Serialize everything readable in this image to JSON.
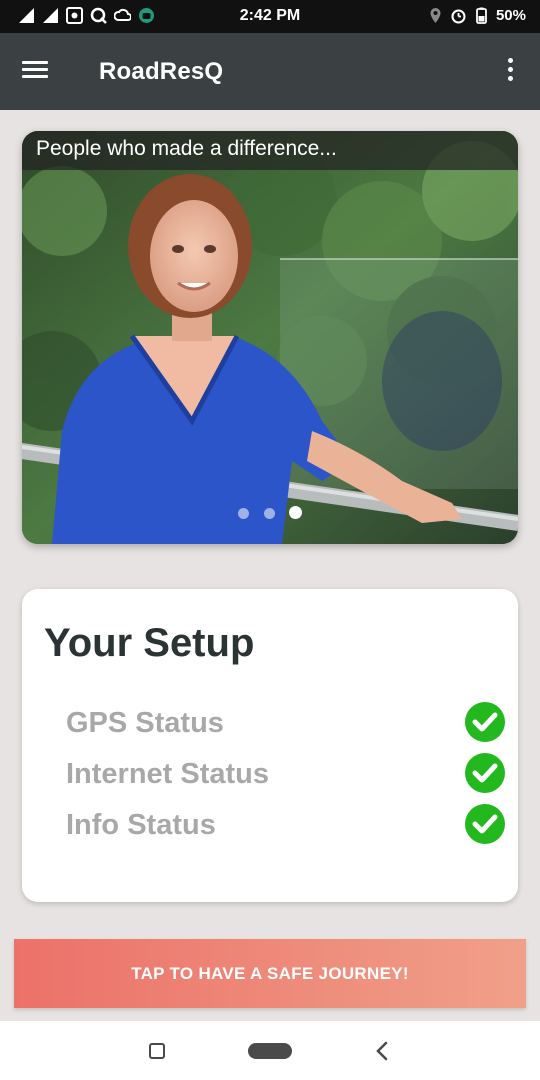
{
  "status_bar": {
    "time": "2:42 PM",
    "battery": "50%",
    "left_icons": [
      "signal-icon",
      "signal-icon",
      "notification-icon",
      "q-icon",
      "cloud-icon",
      "android-icon"
    ],
    "right_icons": [
      "location-icon",
      "alarm-icon",
      "battery-icon"
    ]
  },
  "app_bar": {
    "title": "RoadResQ",
    "menu_icon": "hamburger-menu-icon",
    "overflow_icon": "more-vert-icon"
  },
  "carousel": {
    "caption": "People who made a difference...",
    "slide_count": 3,
    "active_index": 2
  },
  "setup": {
    "title": "Your Setup",
    "items": [
      {
        "label": "GPS Status",
        "ok": true
      },
      {
        "label": "Internet Status",
        "ok": true
      },
      {
        "label": "Info Status",
        "ok": true
      }
    ]
  },
  "cta": {
    "label": "TAP TO HAVE A SAFE JOURNEY!"
  },
  "colors": {
    "app_bar": "#3b4042",
    "background": "#e7e3e2",
    "check_green": "#22b81e",
    "cta_start": "#ec7169",
    "cta_end": "#f0a089"
  }
}
